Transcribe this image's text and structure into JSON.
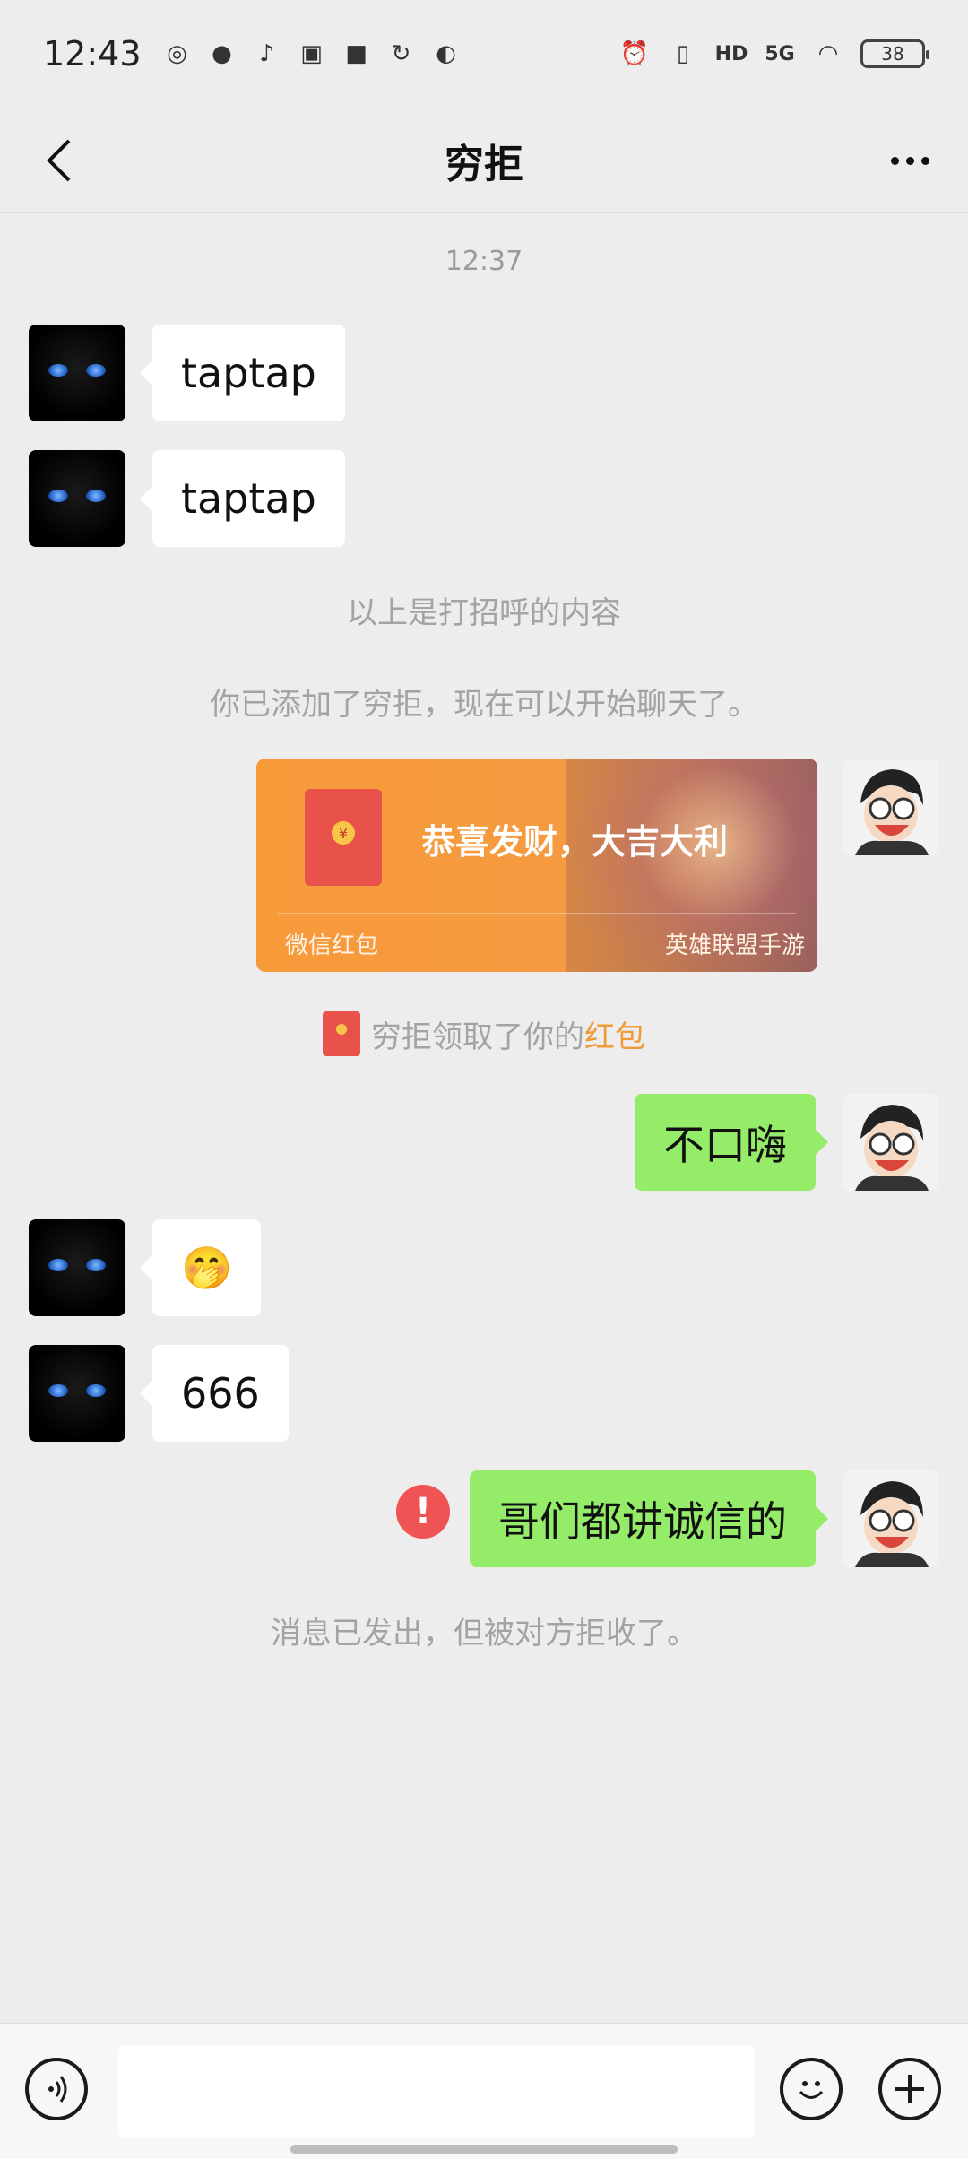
{
  "status_bar": {
    "time": "12:43",
    "battery": "38",
    "network": "5G",
    "hd": "HD",
    "icons_left": [
      "weibo-icon",
      "wechat-icon",
      "tiktok-icon",
      "app-icon",
      "app-icon-2",
      "sync-icon",
      "browser-icon"
    ],
    "icons_right": [
      "alarm-icon",
      "vibrate-icon",
      "hd-icon",
      "signal-icon",
      "wifi-icon",
      "battery-icon"
    ]
  },
  "header": {
    "title": "穷拒",
    "back_icon": "chevron-left-icon",
    "more_icon": "more-dots-icon"
  },
  "chat": {
    "timestamp": "12:37",
    "messages": [
      {
        "side": "left",
        "text": "taptap"
      },
      {
        "side": "left",
        "text": "taptap"
      }
    ],
    "system_greeting": "以上是打招呼的内容",
    "system_added": "你已添加了穷拒，现在可以开始聊天了。",
    "red_packet": {
      "greeting": "恭喜发财，大吉大利",
      "type": "微信红包",
      "source": "英雄联盟手游",
      "coin_symbol": "¥"
    },
    "claimed": {
      "prefix": "穷拒领取了你的",
      "link": "红包"
    },
    "msg_right_1": "不口嗨",
    "msg_left_emoji": "🤭",
    "msg_left_3": "666",
    "msg_right_failed": "哥们都讲诚信的",
    "fail_mark": "!",
    "system_rejected": "消息已发出，但被对方拒收了。"
  },
  "input_bar": {
    "voice_icon": "voice-icon",
    "emoji_icon": "emoji-icon",
    "plus_icon": "plus-icon",
    "placeholder": ""
  },
  "colors": {
    "background": "#ededed",
    "bubble_self": "#95ec69",
    "bubble_other": "#ffffff",
    "red_packet": "#f79a3a",
    "link": "#f09a38",
    "fail": "#f05353"
  }
}
